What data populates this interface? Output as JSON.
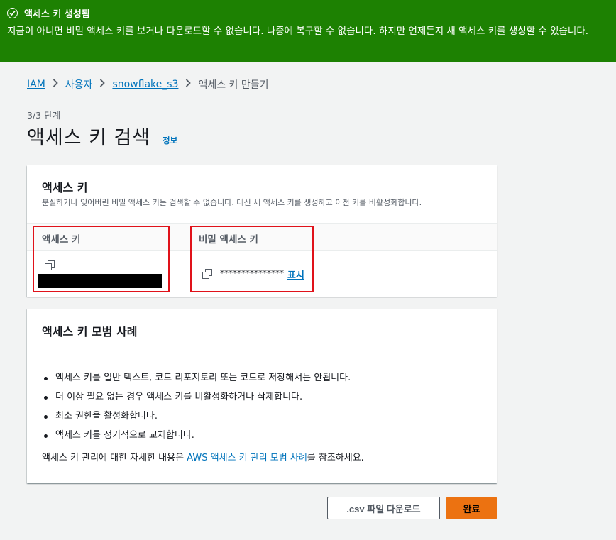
{
  "banner": {
    "title": "액세스 키 생성됨",
    "message": "지금이 아니면 비밀 액세스 키를 보거나 다운로드할 수 없습니다. 나중에 복구할 수 없습니다. 하지만 언제든지 새 액세스 키를 생성할 수 있습니다.",
    "icon": "check-circle-icon",
    "color": "#1d8102"
  },
  "breadcrumb": {
    "items": [
      "IAM",
      "사용자",
      "snowflake_s3"
    ],
    "current": "액세스 키 만들기"
  },
  "page": {
    "step": "3/3 단계",
    "title": "액세스 키 검색",
    "info_link": "정보"
  },
  "keys_panel": {
    "title": "액세스 키",
    "description": "분실하거나 잊어버린 비밀 액세스 키는 검색할 수 없습니다. 대신 새 액세스 키를 생성하고 이전 키를 비활성화합니다.",
    "col_access_key": "액세스 키",
    "col_secret_key": "비밀 액세스 키",
    "secret_masked": "***************",
    "show_label": "표시"
  },
  "best_practices": {
    "title": "액세스 키 모범 사례",
    "items": [
      "액세스 키를 일반 텍스트, 코드 리포지토리 또는 코드로 저장해서는 안됩니다.",
      "더 이상 필요 없는 경우 액세스 키를 비활성화하거나 삭제합니다.",
      "최소 권한을 활성화합니다.",
      "액세스 키를 정기적으로 교체합니다."
    ],
    "ref_prefix": "액세스 키 관리에 대한 자세한 내용은 ",
    "ref_link": "AWS 액세스 키 관리 모범 사례",
    "ref_suffix": "를 참조하세요."
  },
  "footer": {
    "download_label": ".csv 파일 다운로드",
    "done_label": "완료"
  },
  "colors": {
    "link": "#0073bb",
    "primary": "#ec7211",
    "highlight": "#e0121a"
  }
}
